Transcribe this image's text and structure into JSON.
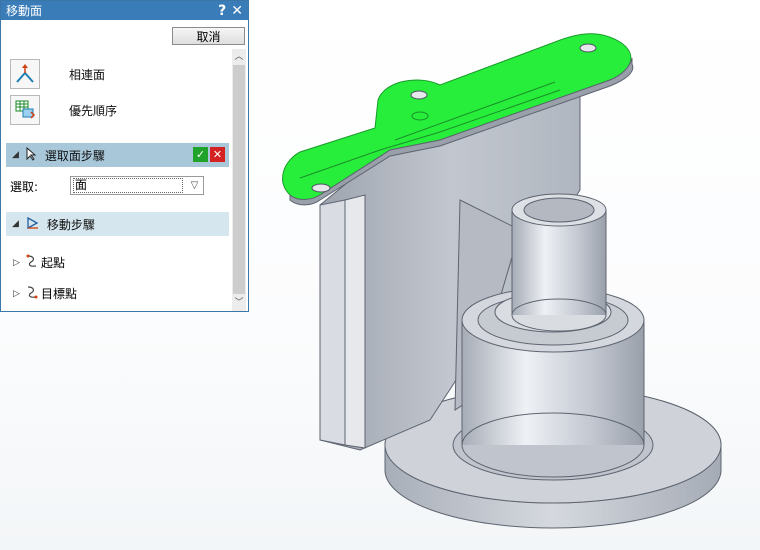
{
  "dialog": {
    "title": "移動面",
    "help_glyph": "?",
    "close_glyph": "✕",
    "cancel_label": "取消",
    "tools": [
      {
        "label": "相連面",
        "icon": "connected-faces-icon"
      },
      {
        "label": "優先順序",
        "icon": "priority-order-icon"
      }
    ],
    "select_step": {
      "label": "選取面步驟"
    },
    "select_field": {
      "label": "選取:",
      "value": "面"
    },
    "move_step": {
      "label": "移動步驟"
    },
    "sub_steps": [
      {
        "label": "起點",
        "icon": "start-point-icon"
      },
      {
        "label": "目標點",
        "icon": "target-point-icon"
      }
    ]
  },
  "colors": {
    "titlebar": "#3a7cb8",
    "step_header_active": "#a8c8da",
    "step_header_inactive": "#d6e6ee",
    "face_highlight": "#26ee3a",
    "part_gray": "#c9ced6"
  }
}
